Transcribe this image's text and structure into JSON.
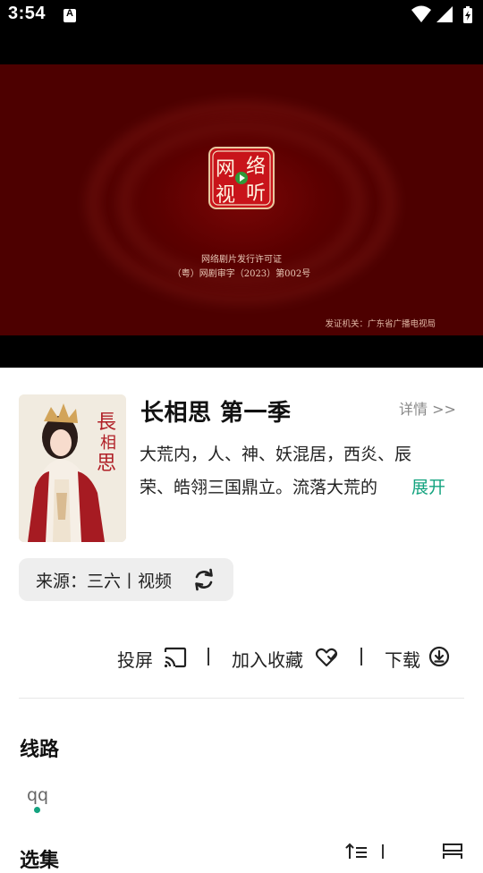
{
  "status_bar": {
    "time": "3:54",
    "notification_icon": "A",
    "icons": [
      "wifi-icon",
      "cell-signal-icon",
      "battery-icon"
    ]
  },
  "video": {
    "seal_chars": [
      "网",
      "络",
      "视",
      "听"
    ],
    "license_line1": "网络剧片发行许可证",
    "license_line2": "（粤）网剧审字（2023）第002号",
    "issuer": "发证机关：广东省广播电视局",
    "background_color": "#5b0000"
  },
  "poster": {
    "title_chars": [
      "長",
      "相",
      "思"
    ]
  },
  "show": {
    "title": "长相思 第一季",
    "details_link": "详情 >>",
    "synopsis_line1": "大荒内，人、神、妖混居，西炎、辰",
    "synopsis_line2": "荣、皓翎三国鼎立。流落大荒的",
    "expand_label": "展开",
    "accent_color": "#14a37f"
  },
  "source": {
    "label": "来源：三六丨视频"
  },
  "actions": {
    "cast_label": "投屏",
    "favorite_label": "加入收藏",
    "download_label": "下载"
  },
  "routes": {
    "title": "线路",
    "items": [
      "qq"
    ]
  },
  "episodes": {
    "title": "选集"
  }
}
